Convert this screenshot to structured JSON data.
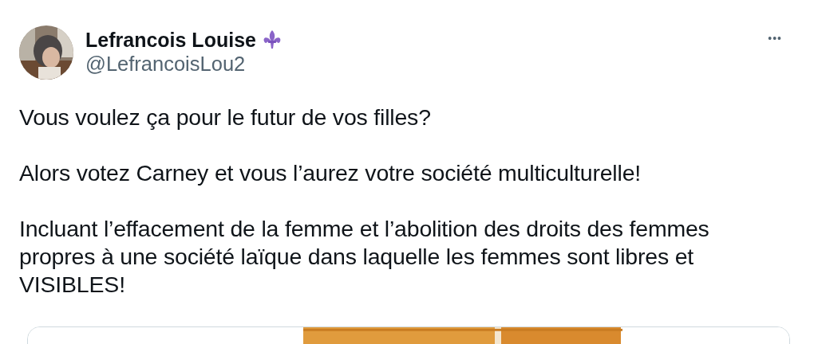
{
  "author": {
    "name": "Lefrancois Louise",
    "handle": "@LefrancoisLou2"
  },
  "more_button": "•••",
  "paragraphs": [
    [
      "Vous voulez ça pour le futur de vos filles?"
    ],
    [
      "Alors votez Carney et vous l’aurez votre société multiculturelle!"
    ],
    [
      "Incluant l’effacement de la femme et l’abolition des droits des femmes",
      "propres à une société laïque dans laquelle les femmes sont libres et",
      "VISIBLES!"
    ]
  ]
}
